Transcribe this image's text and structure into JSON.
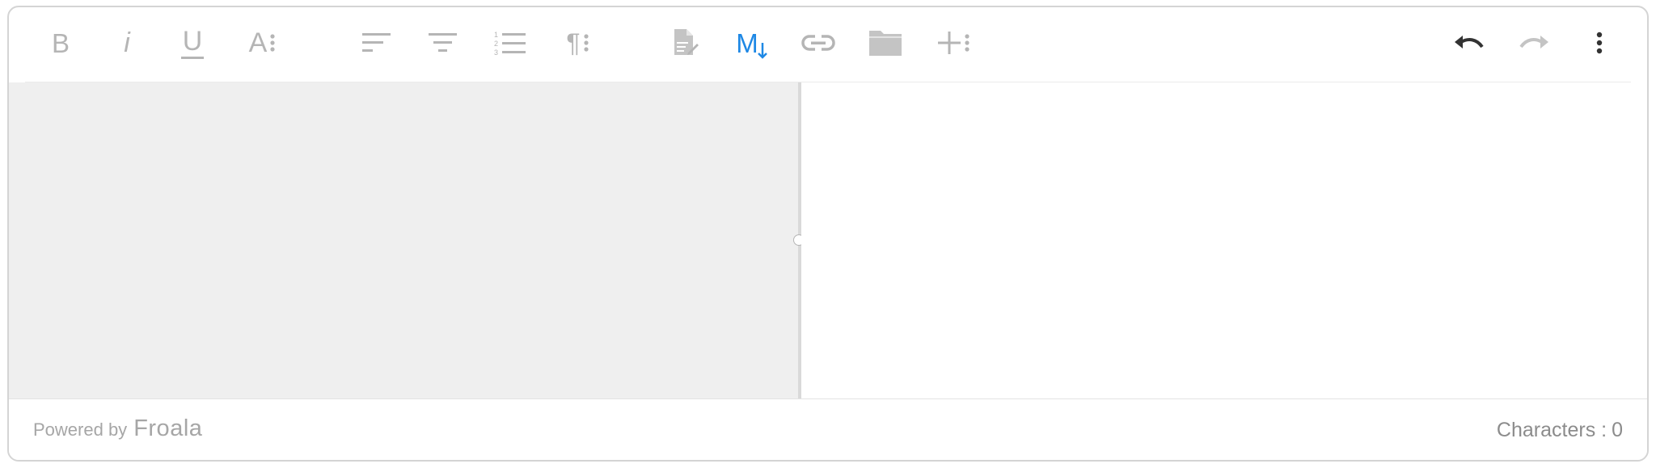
{
  "toolbar": {
    "bold_label": "B",
    "italic_label": "i",
    "underline_label": "U",
    "font_style_label": "A",
    "paragraph_label": "¶",
    "markdown_label": "M",
    "icons": {
      "bold": "bold-icon",
      "italic": "italic-icon",
      "underline": "underline-icon",
      "text_format_more": "text-format-more-icon",
      "align_left": "align-left-icon",
      "align_center": "align-center-icon",
      "ordered_list": "ordered-list-icon",
      "paragraph_more": "paragraph-more-icon",
      "insert_file": "insert-file-icon",
      "markdown": "markdown-icon",
      "insert_link": "insert-link-icon",
      "file_manager": "folder-icon",
      "insert_more": "insert-more-icon",
      "undo": "undo-icon",
      "redo": "redo-icon",
      "more": "more-vertical-icon"
    },
    "colors": {
      "icon_default": "#b5b5b5",
      "markdown_active": "#1e88e5",
      "undo_active": "#333333"
    }
  },
  "footer": {
    "powered_by": "Powered by",
    "brand": "Froala",
    "characters_label": "Characters :",
    "characters_count": "0"
  }
}
